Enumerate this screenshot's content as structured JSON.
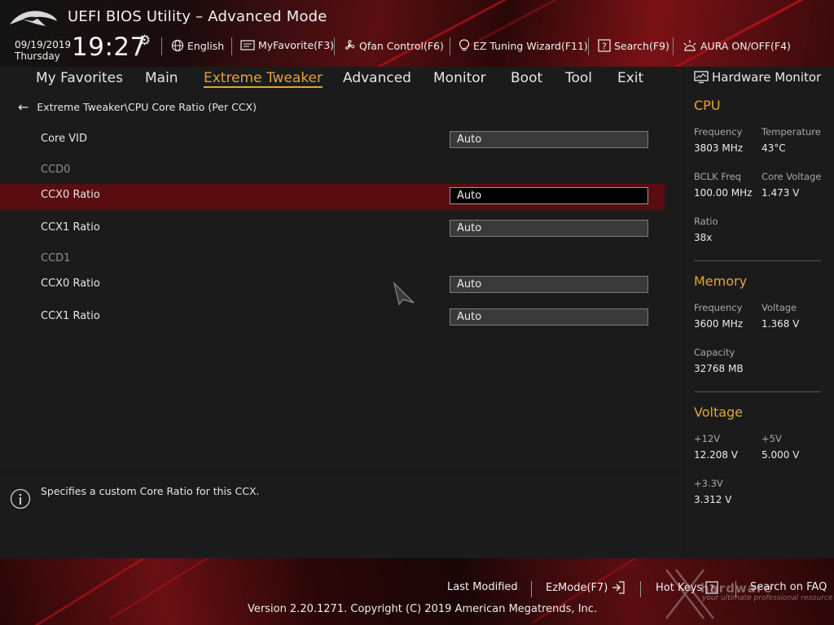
{
  "header": {
    "title": "UEFI BIOS Utility – Advanced Mode",
    "date": "09/19/2019",
    "weekday": "Thursday",
    "time": "19:27",
    "items": [
      {
        "label": "English",
        "icon": "globe-icon"
      },
      {
        "label": "MyFavorite(F3)",
        "icon": "favorite-icon"
      },
      {
        "label": "Qfan Control(F6)",
        "icon": "fan-icon"
      },
      {
        "label": "EZ Tuning Wizard(F11)",
        "icon": "bulb-icon"
      },
      {
        "label": "Search(F9)",
        "icon": "search-help-icon"
      },
      {
        "label": "AURA ON/OFF(F4)",
        "icon": "aura-icon"
      }
    ]
  },
  "nav": {
    "tabs": [
      "My Favorites",
      "Main",
      "Extreme Tweaker",
      "Advanced",
      "Monitor",
      "Boot",
      "Tool",
      "Exit"
    ],
    "active": "Extreme Tweaker"
  },
  "main": {
    "breadcrumb": "Extreme Tweaker\\CPU Core Ratio (Per CCX)",
    "rows": [
      {
        "label": "Core VID",
        "value": "Auto"
      },
      {
        "group": "CCD0"
      },
      {
        "label": "CCX0 Ratio",
        "value": "Auto",
        "selected": true
      },
      {
        "label": "CCX1 Ratio",
        "value": "Auto"
      },
      {
        "group": "CCD1"
      },
      {
        "label": "CCX0 Ratio",
        "value": "Auto"
      },
      {
        "label": "CCX1 Ratio",
        "value": "Auto"
      }
    ]
  },
  "help": {
    "text": "Specifies a custom Core Ratio for this CCX."
  },
  "hwmon": {
    "title": "Hardware Monitor",
    "cpu": {
      "title": "CPU",
      "frequency_label": "Frequency",
      "frequency": "3803 MHz",
      "temperature_label": "Temperature",
      "temperature": "43°C",
      "bclk_label": "BCLK Freq",
      "bclk": "100.00 MHz",
      "core_voltage_label": "Core Voltage",
      "core_voltage": "1.473 V",
      "ratio_label": "Ratio",
      "ratio": "38x"
    },
    "memory": {
      "title": "Memory",
      "frequency_label": "Frequency",
      "frequency": "3600 MHz",
      "voltage_label": "Voltage",
      "voltage": "1.368 V",
      "capacity_label": "Capacity",
      "capacity": "32768 MB"
    },
    "voltage": {
      "title": "Voltage",
      "v12_label": "+12V",
      "v12": "12.208 V",
      "v5_label": "+5V",
      "v5": "5.000 V",
      "v33_label": "+3.3V",
      "v33": "3.312 V"
    }
  },
  "footer": {
    "last_modified": "Last Modified",
    "ezmode": "EzMode(F7)",
    "hotkeys": "Hot Keys",
    "search_faq": "Search on FAQ",
    "version": "Version 2.20.1271. Copyright (C) 2019 American Megatrends, Inc.",
    "watermark": "hardware",
    "watermark_sub": "your ultimate professional resource"
  },
  "colors": {
    "accent": "#e2a43a",
    "selection": "#5a0d10",
    "background": "#1b1b1b"
  }
}
